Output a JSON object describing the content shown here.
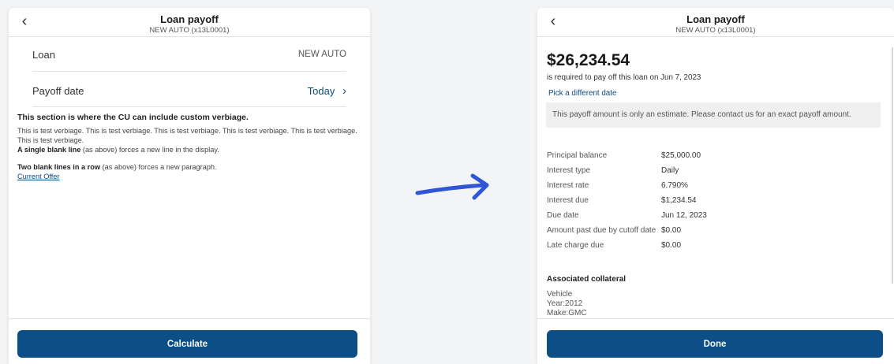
{
  "left_screen": {
    "header": {
      "title": "Loan payoff",
      "subtitle": "NEW AUTO (x13L0001)"
    },
    "rows": [
      {
        "label": "Loan",
        "value": "NEW AUTO"
      },
      {
        "label": "Payoff date",
        "value": "Today",
        "chevron": "›"
      }
    ],
    "custom_section": {
      "heading": "This section is where the CU can include custom verbiage.",
      "paragraph1": "This is test verbiage. This is test verbiage. This is test verbiage. This is test verbiage. This is test verbiage. This is test verbiage.",
      "line2_bold": "A single blank line",
      "line2_rest": " (as above) forces a new line in the display.",
      "line3_bold": "Two blank lines in a row",
      "line3_rest": " (as above) forces a new paragraph.",
      "link": "Current Offer"
    },
    "button": "Calculate"
  },
  "right_screen": {
    "header": {
      "title": "Loan payoff",
      "subtitle": "NEW AUTO (x13L0001)"
    },
    "amount": "$26,234.54",
    "required_text": "is required to pay off this loan on Jun 7, 2023",
    "pick_date": "Pick a different date",
    "notice": "This payoff amount is only an estimate. Please contact us for an exact payoff amount.",
    "details": [
      {
        "label": "Principal balance",
        "value": "$25,000.00"
      },
      {
        "label": "Interest type",
        "value": "Daily"
      },
      {
        "label": "Interest rate",
        "value": "6.790%"
      },
      {
        "label": "Interest due",
        "value": "$1,234.54"
      },
      {
        "label": "Due date",
        "value": "Jun 12, 2023"
      },
      {
        "label": "Amount past due by cutoff date",
        "value": "$0.00"
      },
      {
        "label": "Late charge due",
        "value": "$0.00"
      }
    ],
    "collateral_heading": "Associated collateral",
    "collateral_lines": [
      "Vehicle",
      "Year:2012",
      "Make:GMC"
    ],
    "button": "Done"
  },
  "icons": {
    "back": "‹",
    "arrow_color": "#2f56d6"
  },
  "colors": {
    "primary_button": "#0b4f86",
    "link": "#0b4a7f"
  }
}
